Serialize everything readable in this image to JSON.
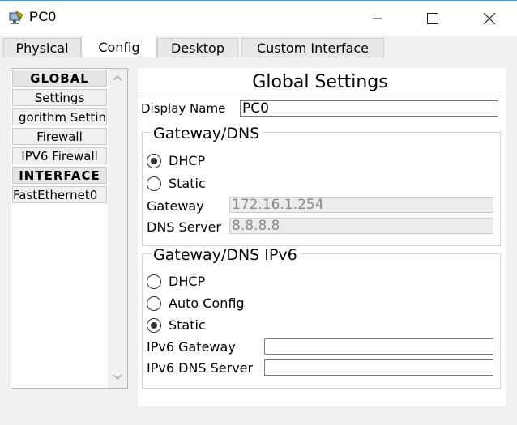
{
  "window": {
    "title": "PC0"
  },
  "tabs": [
    {
      "label": "Physical"
    },
    {
      "label": "Config"
    },
    {
      "label": "Desktop"
    },
    {
      "label": "Custom Interface"
    }
  ],
  "sidebar": {
    "items": [
      {
        "label": "GLOBAL"
      },
      {
        "label": "Settings"
      },
      {
        "label": "gorithm Settin"
      },
      {
        "label": "Firewall"
      },
      {
        "label": "IPV6 Firewall"
      },
      {
        "label": "INTERFACE"
      },
      {
        "label": "FastEthernet0"
      }
    ]
  },
  "panel": {
    "title": "Global Settings",
    "display_name_label": "Display Name",
    "display_name_value": "PC0",
    "gateway_dns": {
      "title": "Gateway/DNS",
      "dhcp_label": "DHCP",
      "static_label": "Static",
      "selected": "DHCP",
      "gateway_label": "Gateway",
      "gateway_value": "172.16.1.254",
      "dns_label": "DNS Server",
      "dns_value": "8.8.8.8"
    },
    "gateway_dns_ipv6": {
      "title": "Gateway/DNS IPv6",
      "dhcp_label": "DHCP",
      "auto_label": "Auto Config",
      "static_label": "Static",
      "selected": "Static",
      "gateway_label": "IPv6 Gateway",
      "gateway_value": "",
      "dns_label": "IPv6 DNS Server",
      "dns_value": ""
    }
  }
}
